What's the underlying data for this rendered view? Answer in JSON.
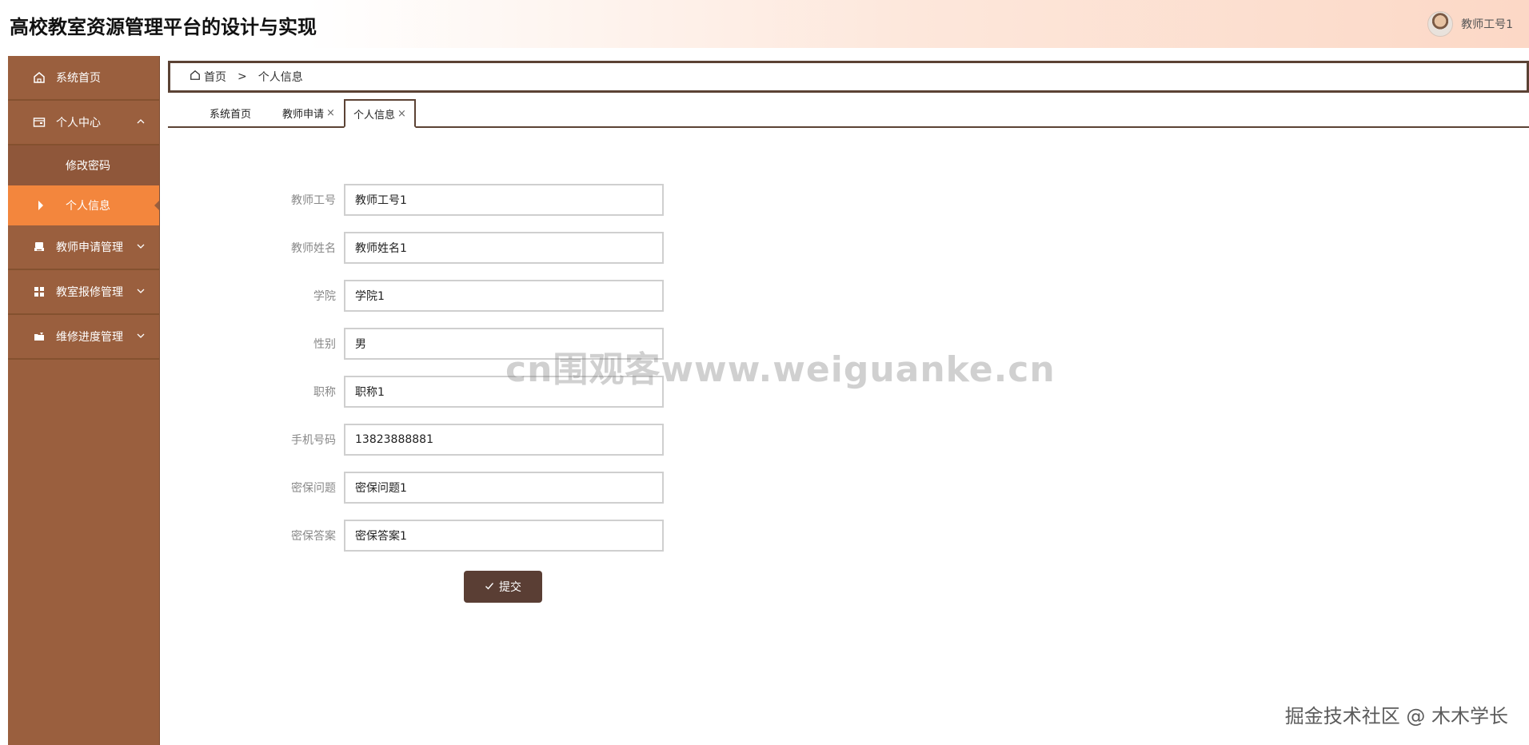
{
  "app": {
    "title": "高校教室资源管理平台的设计与实现",
    "user_name": "教师工号1"
  },
  "sidebar": {
    "items": [
      {
        "label": "系统首页",
        "icon": "home-icon"
      },
      {
        "label": "个人中心",
        "icon": "wallet-icon",
        "expanded": true,
        "children": [
          {
            "label": "修改密码"
          },
          {
            "label": "个人信息",
            "active": true
          }
        ]
      },
      {
        "label": "教师申请管理",
        "icon": "printer-icon"
      },
      {
        "label": "教室报修管理",
        "icon": "grid-icon"
      },
      {
        "label": "维修进度管理",
        "icon": "folder-icon"
      }
    ]
  },
  "breadcrumb": {
    "home": "首页",
    "separator": ">",
    "current": "个人信息"
  },
  "tabs": [
    {
      "label": "系统首页",
      "closable": false
    },
    {
      "label": "教师申请",
      "closable": true
    },
    {
      "label": "个人信息",
      "closable": true,
      "active": true
    }
  ],
  "tab_close_glyph": "×",
  "form": {
    "fields": [
      {
        "label": "教师工号",
        "value": "教师工号1"
      },
      {
        "label": "教师姓名",
        "value": "教师姓名1"
      },
      {
        "label": "学院",
        "value": "学院1"
      },
      {
        "label": "性别",
        "value": "男"
      },
      {
        "label": "职称",
        "value": "职称1"
      },
      {
        "label": "手机号码",
        "value": "13823888881"
      },
      {
        "label": "密保问题",
        "value": "密保问题1"
      },
      {
        "label": "密保答案",
        "value": "密保答案1"
      }
    ],
    "submit_label": "提交"
  },
  "watermarks": {
    "center": "cn围观客www.weiguanke.cn",
    "footer": "掘金技术社区 @ 木木学长"
  },
  "colors": {
    "sidebar": "#9a5f3e",
    "active_item": "#f3863d",
    "accent_dark": "#5b4234",
    "button": "#5a3e34"
  }
}
